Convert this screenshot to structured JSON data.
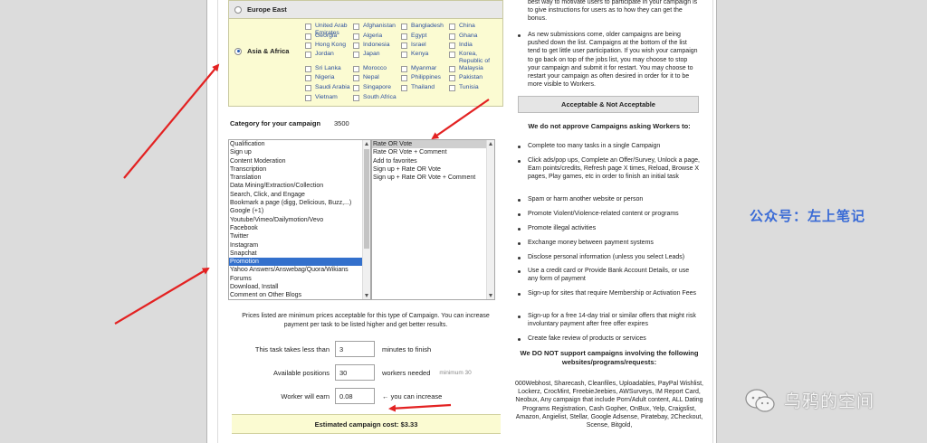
{
  "regions": {
    "europe_east": {
      "label": "Europe East",
      "selected": false
    },
    "asia_africa": {
      "label": "Asia & Africa",
      "selected": true
    },
    "countries": [
      [
        "United Arab Emirates",
        "Afghanistan",
        "Bangladesh",
        "China"
      ],
      [
        "Georgia",
        "Algeria",
        "Egypt",
        "Ghana"
      ],
      [
        "Hong Kong",
        "Indonesia",
        "Israel",
        "India"
      ],
      [
        "Jordan",
        "Japan",
        "Kenya",
        "Korea, Republic of"
      ],
      [
        "Sri Lanka",
        "Morocco",
        "Myanmar",
        "Malaysia"
      ],
      [
        "Nigeria",
        "Nepal",
        "Philippines",
        "Pakistan"
      ],
      [
        "Saudi Arabia",
        "Singapore",
        "Thailand",
        "Tunisia"
      ],
      [
        "Vietnam",
        "South Africa",
        "",
        ""
      ]
    ]
  },
  "category": {
    "label": "Category for your campaign",
    "count": "3500",
    "options": [
      "Qualification",
      "Sign up",
      "Content Moderation",
      "Transcription",
      "Translation",
      "Data Mining/Extraction/Collection",
      "Search, Click, and Engage",
      "Bookmark a page (digg, Delicious, Buzz,...)",
      "Google (+1)",
      "Youtube/Vimeo/Dailymotion/Vevo",
      "Facebook",
      "Twitter",
      "Instagram",
      "Snapchat",
      "Promotion",
      "Yahoo Answers/Answebag/Quora/Wikians",
      "Forums",
      "Download, Install",
      "Comment on Other Blogs"
    ],
    "selected": "Promotion",
    "sub_options": [
      "Rate OR Vote",
      "Rate OR Vote + Comment",
      "Add to favorites",
      "Sign up + Rate OR Vote",
      "Sign up + Rate OR Vote + Comment"
    ],
    "sub_selected": "Rate OR Vote"
  },
  "pricing": {
    "note": "Prices listed are minimum prices acceptable for this type of Campaign. You can increase payment per task to be listed higher and get better results.",
    "duration_label": "This task takes less than",
    "duration_value": "3",
    "duration_unit": "minutes to finish",
    "positions_label": "Available positions",
    "positions_value": "30",
    "positions_unit": "workers needed",
    "positions_hint": "minimum 30",
    "earn_label": "Worker will earn",
    "earn_value": "0.08",
    "earn_hint": "← you can increase",
    "estimated_cost": "Estimated campaign cost: $3.33"
  },
  "sidebar": {
    "intro": "best way to motivate users to participate in your campaign is to give instructions for users as to how they can get the bonus.",
    "tip": "As new submissions come, older campaigns are being pushed down the list. Campaigns at the bottom of the list tend to get little user participation. If you wish your campaign to go back on top of the jobs list, you may choose to stop your campaign and submit it for restart. You may choose to restart your campaign as often desired in order for it to be more visible to Workers.",
    "box_title": "Acceptable & Not Acceptable",
    "not_approve_heading": "We do not approve Campaigns asking Workers to:",
    "rules": [
      "Complete too many tasks in a single Campaign",
      "Click ads/pop ups, Complete an Offer/Survey, Unlock a page, Earn points/credits, Refresh page X times, Reload, Browse X pages, Play games, etc in order to finish an initial task",
      "Spam or harm another website or person",
      "Promote Violent/Violence-related content or programs",
      "Promote illegal activities",
      "Exchange money between payment systems",
      "Disclose personal information (unless you select Leads)",
      "Use a credit card or Provide Bank Account Details, or use any form of payment",
      "Sign-up for sites that require Membership or Activation Fees",
      "Sign-up for a free 14-day trial or similar offers that might risk involuntary payment after free offer expires",
      "Create fake review of products or services"
    ],
    "not_support_heading": "We DO NOT support campaigns involving the following websites/programs/requests:",
    "sites": "000Webhost, Sharecash, Cleanfiles, Uploadables, PayPal Wishlist, Lockerz, CrocMint, FreebieJeebies, AWSurveys, IM Report Card, Neobux, Any campaign that include Porn/Adult content, ALL Dating Programs Registration, Cash Gopher, OnBux, Yelp, Craigslist, Amazon, Angielist, Stellar, Google Adsense, Piratebay, 2Checkout, Scense, Bitgold,"
  },
  "watermarks": {
    "account": "公众号：左上笔记",
    "channel": "乌鸦的空间"
  },
  "colors": {
    "region_bg": "#fbfbd2",
    "selection_blue": "#3370cc",
    "arrow_red": "#e32222",
    "country_link": "#2b4f9e"
  }
}
